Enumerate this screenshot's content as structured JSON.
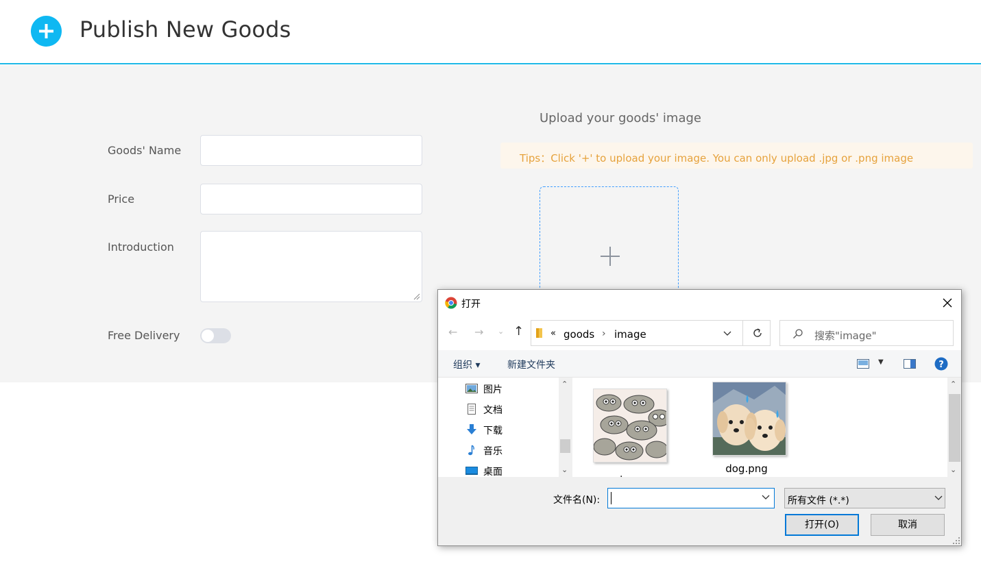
{
  "header": {
    "title": "Publish New Goods"
  },
  "form": {
    "name_label": "Goods' Name",
    "price_label": "Price",
    "intro_label": "Introduction",
    "delivery_label": "Free Delivery",
    "free_delivery": false
  },
  "upload": {
    "title": "Upload your goods' image",
    "tips": "Tips：Click '+' to upload your image. You can only upload .jpg or .png image"
  },
  "dialog": {
    "title": "打开",
    "breadcrumb": {
      "overflow": "«",
      "parts": [
        "goods",
        "image"
      ]
    },
    "search_placeholder": "搜索\"image\"",
    "organize_label": "组织 ▾",
    "new_folder_label": "新建文件夹",
    "tree": [
      "图片",
      "文档",
      "下载",
      "音乐",
      "桌面"
    ],
    "files": [
      {
        "name": "cat.png"
      },
      {
        "name": "dog.png"
      }
    ],
    "filename_label": "文件名(N):",
    "filename_value": "",
    "filter_label": "所有文件 (*.*)",
    "open_label": "打开(O)",
    "cancel_label": "取消"
  },
  "colors": {
    "accent": "#0fb8f2",
    "header_line": "#1cb8e6",
    "tips_bg": "#fdf6ec",
    "tips_text": "#e6a23c",
    "dialog_focus": "#0078d7"
  }
}
